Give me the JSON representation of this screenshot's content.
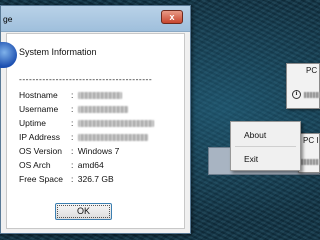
{
  "dialog": {
    "title": "ge",
    "close_glyph": "x",
    "heading": "System Information",
    "dashes": "----------------------------------------",
    "rows": [
      {
        "label": "Hostname",
        "value": ""
      },
      {
        "label": "Username",
        "value": ""
      },
      {
        "label": "Uptime",
        "value": ""
      },
      {
        "label": "IP Address",
        "value": ""
      },
      {
        "label": "OS Version",
        "value": "Windows 7"
      },
      {
        "label": "OS Arch",
        "value": "amd64"
      },
      {
        "label": "Free Space",
        "value": "326.7 GB"
      }
    ],
    "ok_label": "OK"
  },
  "tray": {
    "popup_top_label": "PC",
    "popup_bottom_label": "PC I",
    "info_glyph": "i"
  },
  "context_menu": {
    "items": [
      "About",
      "Exit"
    ]
  }
}
